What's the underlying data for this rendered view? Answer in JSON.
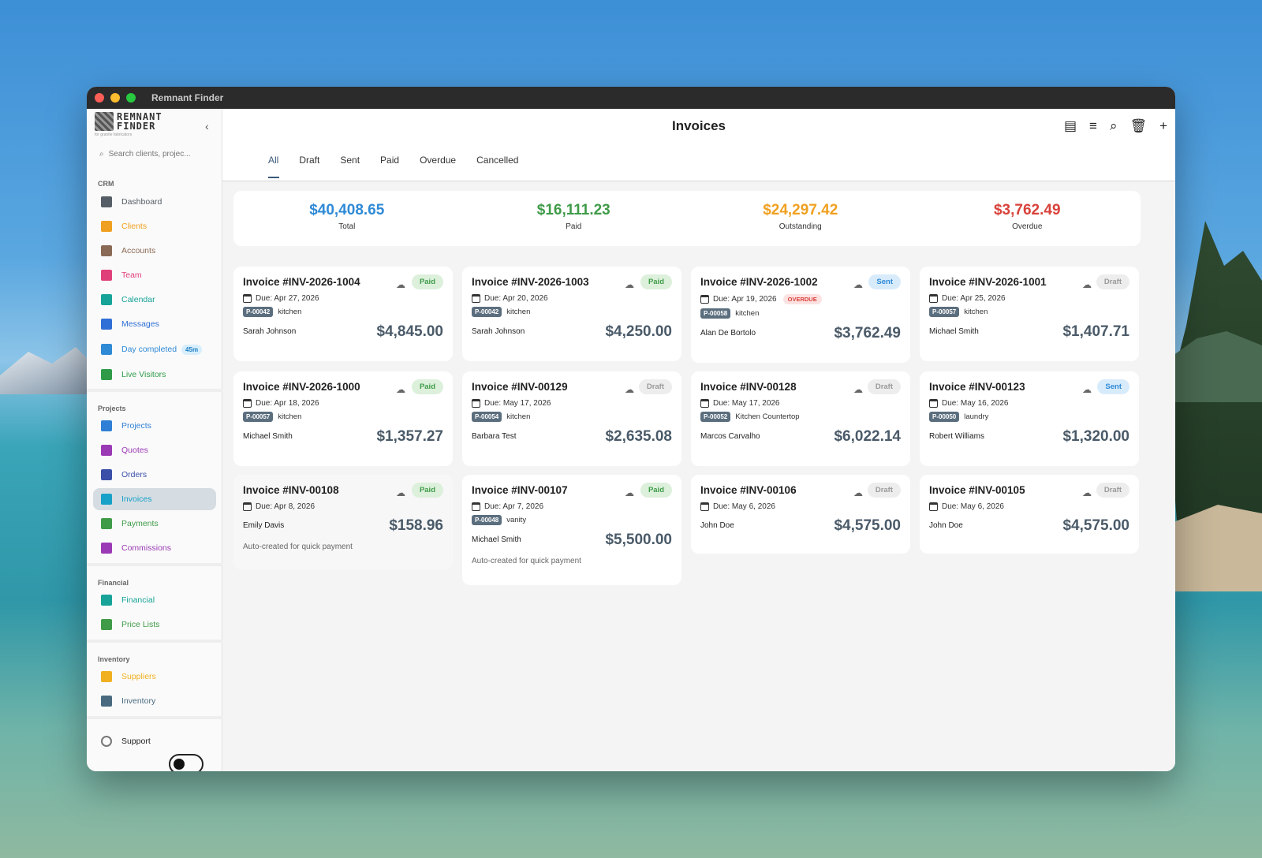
{
  "window": {
    "title": "Remnant Finder"
  },
  "logo": {
    "line1": "REMNANT",
    "line2": "FINDER",
    "tagline": "for granite fabricators"
  },
  "sidebar": {
    "search_placeholder": "Search clients, projec...",
    "sections": {
      "crm": "CRM",
      "projects": "Projects",
      "financial": "Financial",
      "inventory": "Inventory"
    },
    "items": [
      {
        "label": "Dashboard",
        "icon": "dashboard-icon",
        "color": "#555e66"
      },
      {
        "label": "Clients",
        "icon": "clients-icon",
        "color": "#f0a020"
      },
      {
        "label": "Accounts",
        "icon": "accounts-icon",
        "color": "#8a6a55"
      },
      {
        "label": "Team",
        "icon": "team-icon",
        "color": "#e0407a"
      },
      {
        "label": "Calendar",
        "icon": "calendar-icon",
        "color": "#17a398"
      },
      {
        "label": "Messages",
        "icon": "messages-icon",
        "color": "#2f6fd6"
      },
      {
        "label": "Day completed",
        "icon": "check-circle-icon",
        "color": "#2f8ad6",
        "badge": "45m"
      },
      {
        "label": "Live Visitors",
        "icon": "live-visitors-icon",
        "color": "#2f9b48"
      },
      {
        "label": "Projects",
        "icon": "folder-icon",
        "color": "#2f7fd6"
      },
      {
        "label": "Quotes",
        "icon": "quotes-icon",
        "color": "#9b3ab5"
      },
      {
        "label": "Orders",
        "icon": "orders-icon",
        "color": "#3a4fa8"
      },
      {
        "label": "Invoices",
        "icon": "invoice-icon",
        "color": "#17a0c8"
      },
      {
        "label": "Payments",
        "icon": "payments-icon",
        "color": "#3f9b48"
      },
      {
        "label": "Commissions",
        "icon": "commissions-icon",
        "color": "#9b3ab5"
      },
      {
        "label": "Financial",
        "icon": "wallet-icon",
        "color": "#17a398"
      },
      {
        "label": "Price Lists",
        "icon": "price-list-icon",
        "color": "#3f9b48"
      },
      {
        "label": "Suppliers",
        "icon": "truck-icon",
        "color": "#f0b020"
      },
      {
        "label": "Inventory",
        "icon": "inventory-icon",
        "color": "#4a6a80"
      }
    ],
    "support": "Support"
  },
  "header": {
    "title": "Invoices",
    "tools": [
      "list-view-icon",
      "filter-icon",
      "search-icon",
      "delete-icon",
      "add-icon"
    ]
  },
  "tabs": [
    "All",
    "Draft",
    "Sent",
    "Paid",
    "Overdue",
    "Cancelled"
  ],
  "summary": [
    {
      "value": "$40,408.65",
      "label": "Total",
      "color": "#2f8ad6"
    },
    {
      "value": "$16,111.23",
      "label": "Paid",
      "color": "#3f9b48"
    },
    {
      "value": "$24,297.42",
      "label": "Outstanding",
      "color": "#f0a020"
    },
    {
      "value": "$3,762.49",
      "label": "Overdue",
      "color": "#d8423a"
    }
  ],
  "invoices": [
    {
      "title": "Invoice #INV-2026-1004",
      "status": "Paid",
      "due": "Due: Apr 27, 2026",
      "project": "P-00042",
      "area": "kitchen",
      "client": "Sarah Johnson",
      "amount": "$4,845.00"
    },
    {
      "title": "Invoice #INV-2026-1003",
      "status": "Paid",
      "due": "Due: Apr 20, 2026",
      "project": "P-00042",
      "area": "kitchen",
      "client": "Sarah Johnson",
      "amount": "$4,250.00"
    },
    {
      "title": "Invoice #INV-2026-1002",
      "status": "Sent",
      "due": "Due: Apr 19, 2026",
      "overdue": "OVERDUE",
      "project": "P-00058",
      "area": "kitchen",
      "client": "Alan De Bortolo",
      "amount": "$3,762.49"
    },
    {
      "title": "Invoice #INV-2026-1001",
      "status": "Draft",
      "due": "Due: Apr 25, 2026",
      "project": "P-00057",
      "area": "kitchen",
      "client": "Michael Smith",
      "amount": "$1,407.71"
    },
    {
      "title": "Invoice #INV-2026-1000",
      "status": "Paid",
      "due": "Due: Apr 18, 2026",
      "project": "P-00057",
      "area": "kitchen",
      "client": "Michael Smith",
      "amount": "$1,357.27"
    },
    {
      "title": "Invoice #INV-00129",
      "status": "Draft",
      "due": "Due: May 17, 2026",
      "project": "P-00054",
      "area": "kitchen",
      "client": "Barbara Test",
      "amount": "$2,635.08"
    },
    {
      "title": "Invoice #INV-00128",
      "status": "Draft",
      "due": "Due: May 17, 2026",
      "project": "P-00052",
      "area": "Kitchen Countertop",
      "client": "Marcos Carvalho",
      "amount": "$6,022.14"
    },
    {
      "title": "Invoice #INV-00123",
      "status": "Sent",
      "due": "Due: May 16, 2026",
      "project": "P-00050",
      "area": "laundry",
      "client": "Robert Williams",
      "amount": "$1,320.00"
    },
    {
      "title": "Invoice #INV-00108",
      "status": "Paid",
      "due": "Due: Apr 8, 2026",
      "client": "Emily Davis",
      "amount": "$158.96",
      "note": "Auto-created for quick payment"
    },
    {
      "title": "Invoice #INV-00107",
      "status": "Paid",
      "due": "Due: Apr 7, 2026",
      "project": "P-00048",
      "area": "vanity",
      "client": "Michael Smith",
      "amount": "$5,500.00",
      "note": "Auto-created for quick payment"
    },
    {
      "title": "Invoice #INV-00106",
      "status": "Draft",
      "due": "Due: May 6, 2026",
      "client": "John Doe",
      "amount": "$4,575.00"
    },
    {
      "title": "Invoice #INV-00105",
      "status": "Draft",
      "due": "Due: May 6, 2026",
      "client": "John Doe",
      "amount": "$4,575.00"
    }
  ]
}
